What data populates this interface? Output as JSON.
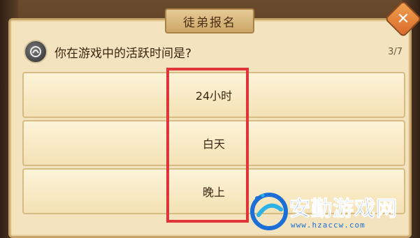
{
  "dialog": {
    "title": "徒弟报名",
    "close_symbol": "✕"
  },
  "question": {
    "text": "你在游戏中的活跃时间是?",
    "page": "3/7",
    "icon": "avatar-icon"
  },
  "options": [
    {
      "label": "24小时"
    },
    {
      "label": "白天"
    },
    {
      "label": "晚上"
    }
  ],
  "watermark": {
    "title": "安勤游戏网",
    "url": "www.hzaccw.com"
  },
  "colors": {
    "highlight": "#e0343a",
    "watermark": "#1b6fd6",
    "panel": "#f3e3be"
  }
}
